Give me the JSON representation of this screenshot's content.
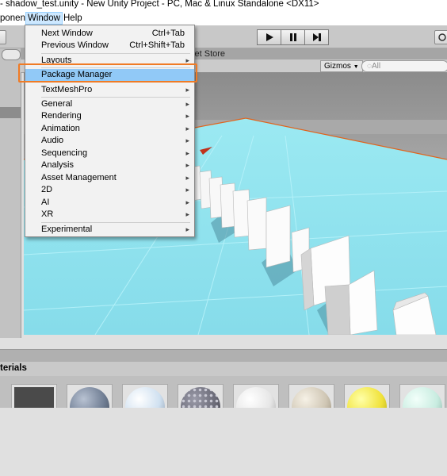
{
  "window": {
    "title": "- shadow_test.unity - New Unity Project - PC, Mac & Linux Standalone <DX11>"
  },
  "menubar": {
    "items": [
      "ponent",
      "Window",
      "Help"
    ]
  },
  "scene": {
    "tab_label": "set Store",
    "gizmos_label": "Gizmos",
    "search_placeholder": "◌All"
  },
  "window_menu": {
    "items": [
      {
        "label": "Next Window",
        "shortcut": "Ctrl+Tab"
      },
      {
        "label": "Previous Window",
        "shortcut": "Ctrl+Shift+Tab"
      },
      {
        "label": "Layouts",
        "submenu": true
      },
      {
        "label": "Package Manager",
        "highlighted": true
      },
      {
        "label": "TextMeshPro",
        "submenu": true
      },
      {
        "label": "General",
        "submenu": true
      },
      {
        "label": "Rendering",
        "submenu": true
      },
      {
        "label": "Animation",
        "submenu": true
      },
      {
        "label": "Audio",
        "submenu": true
      },
      {
        "label": "Sequencing",
        "submenu": true
      },
      {
        "label": "Analysis",
        "submenu": true
      },
      {
        "label": "Asset Management",
        "submenu": true
      },
      {
        "label": "2D",
        "submenu": true
      },
      {
        "label": "AI",
        "submenu": true
      },
      {
        "label": "XR",
        "submenu": true
      },
      {
        "label": "Experimental",
        "submenu": true
      }
    ]
  },
  "project": {
    "header_label": "terials",
    "materials": [
      {
        "color": "#4a4a4a"
      },
      {
        "color": "#6f7d93"
      },
      {
        "color": "#cfe0f0"
      },
      {
        "color": "#6b6b78"
      },
      {
        "color": "#e6e6e6"
      },
      {
        "color": "#cfc6b4"
      },
      {
        "color": "#f0e23a"
      },
      {
        "color": "#c8ece0"
      }
    ]
  },
  "colors": {
    "highlight_border": "#f07b25",
    "menu_hover": "#91c9f7",
    "floor": "#8ee3f0"
  }
}
